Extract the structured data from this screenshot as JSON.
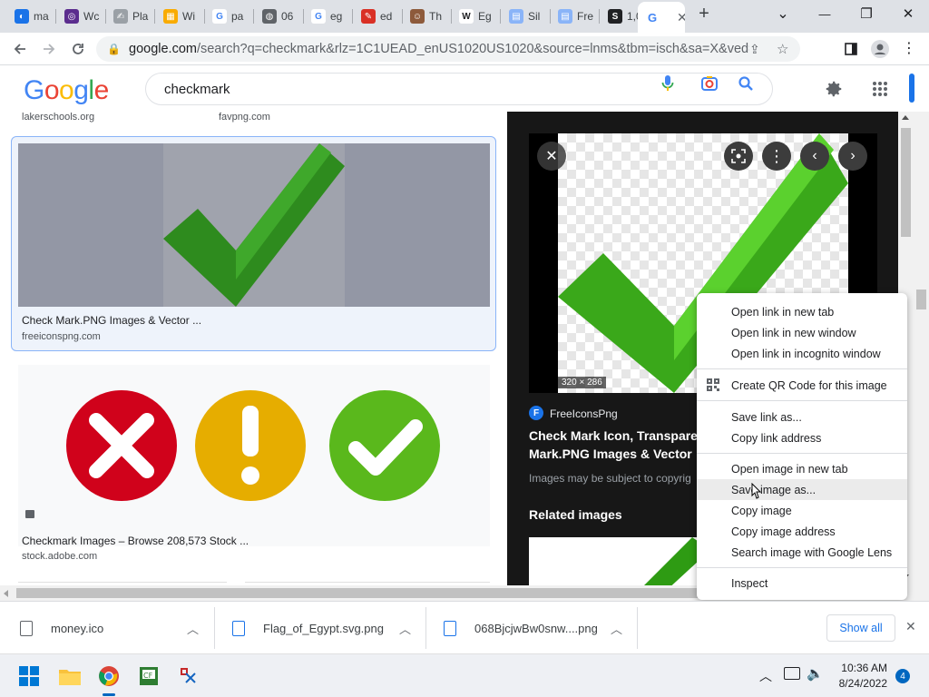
{
  "tabs": [
    {
      "label": "ma",
      "icon": "blue-drop-icon",
      "color": "#1a73e8"
    },
    {
      "label": "Wc",
      "icon": "purple-circle-icon",
      "color": "#5b2d8e"
    },
    {
      "label": "Pla",
      "icon": "feather-icon",
      "color": "#9aa0a6"
    },
    {
      "label": "Wi",
      "icon": "film-icon",
      "color": "#f9ab00"
    },
    {
      "label": "pa",
      "icon": "google-icon",
      "color": "#4285f4"
    },
    {
      "label": "06",
      "icon": "globe-icon",
      "color": "#5f6368"
    },
    {
      "label": "eg",
      "icon": "google-icon",
      "color": "#4285f4"
    },
    {
      "label": "ed",
      "icon": "red-square-icon",
      "color": "#d93025"
    },
    {
      "label": "Th",
      "icon": "portrait-icon",
      "color": "#8d5a3b"
    },
    {
      "label": "Eg",
      "icon": "wikipedia-icon",
      "color": "#202124"
    },
    {
      "label": "Sil",
      "icon": "doc-icon",
      "color": "#8ab4f8"
    },
    {
      "label": "Fre",
      "icon": "doc-icon",
      "color": "#8ab4f8"
    },
    {
      "label": "1,0",
      "icon": "s-icon",
      "color": "#202124"
    }
  ],
  "active_tab": {
    "icon": "google-icon"
  },
  "window": {
    "chevron": "⌄",
    "minimize": "—",
    "restore": "❐",
    "close": "✕"
  },
  "toolbar": {
    "url_host": "google.com",
    "url_rest": "/search?q=checkmark&rlz=1C1UEAD_enUS1020US1020&source=lnms&tbm=isch&sa=X&ved=2ah..."
  },
  "google": {
    "logo_letters": [
      {
        "ch": "G",
        "color": "#4285f4"
      },
      {
        "ch": "o",
        "color": "#ea4335"
      },
      {
        "ch": "o",
        "color": "#fbbc05"
      },
      {
        "ch": "g",
        "color": "#4285f4"
      },
      {
        "ch": "l",
        "color": "#34a853"
      },
      {
        "ch": "e",
        "color": "#ea4335"
      }
    ],
    "query": "checkmark"
  },
  "results": {
    "top_sources": [
      "lakerschools.org",
      "favpng.com"
    ],
    "card1": {
      "title": "Check Mark.PNG Images & Vector ...",
      "source": "freeiconspng.com"
    },
    "card2": {
      "title": "Checkmark Images – Browse 208,573 Stock ...",
      "source": "stock.adobe.com"
    }
  },
  "preview": {
    "dims": "320 × 286",
    "site": "FreeIconsPng",
    "title_line1": "Check Mark Icon, Transpare",
    "title_line2": "Mark.PNG Images & Vector",
    "note": "Images may be subject to copyrig",
    "related": "Related images"
  },
  "context_menu": {
    "items": [
      "Open link in new tab",
      "Open link in new window",
      "Open link in incognito window",
      "Create QR Code for this image",
      "Save link as...",
      "Copy link address",
      "Open image in new tab",
      "Save image as...",
      "Copy image",
      "Copy image address",
      "Search image with Google Lens",
      "Inspect"
    ],
    "highlighted": "Save image as..."
  },
  "downloads": {
    "items": [
      "money.ico",
      "Flag_of_Egypt.svg.png",
      "068BjcjwBw0snw....png"
    ],
    "show_all": "Show all"
  },
  "taskbar": {
    "time": "10:36 AM",
    "date": "8/24/2022",
    "notifications": "4"
  }
}
